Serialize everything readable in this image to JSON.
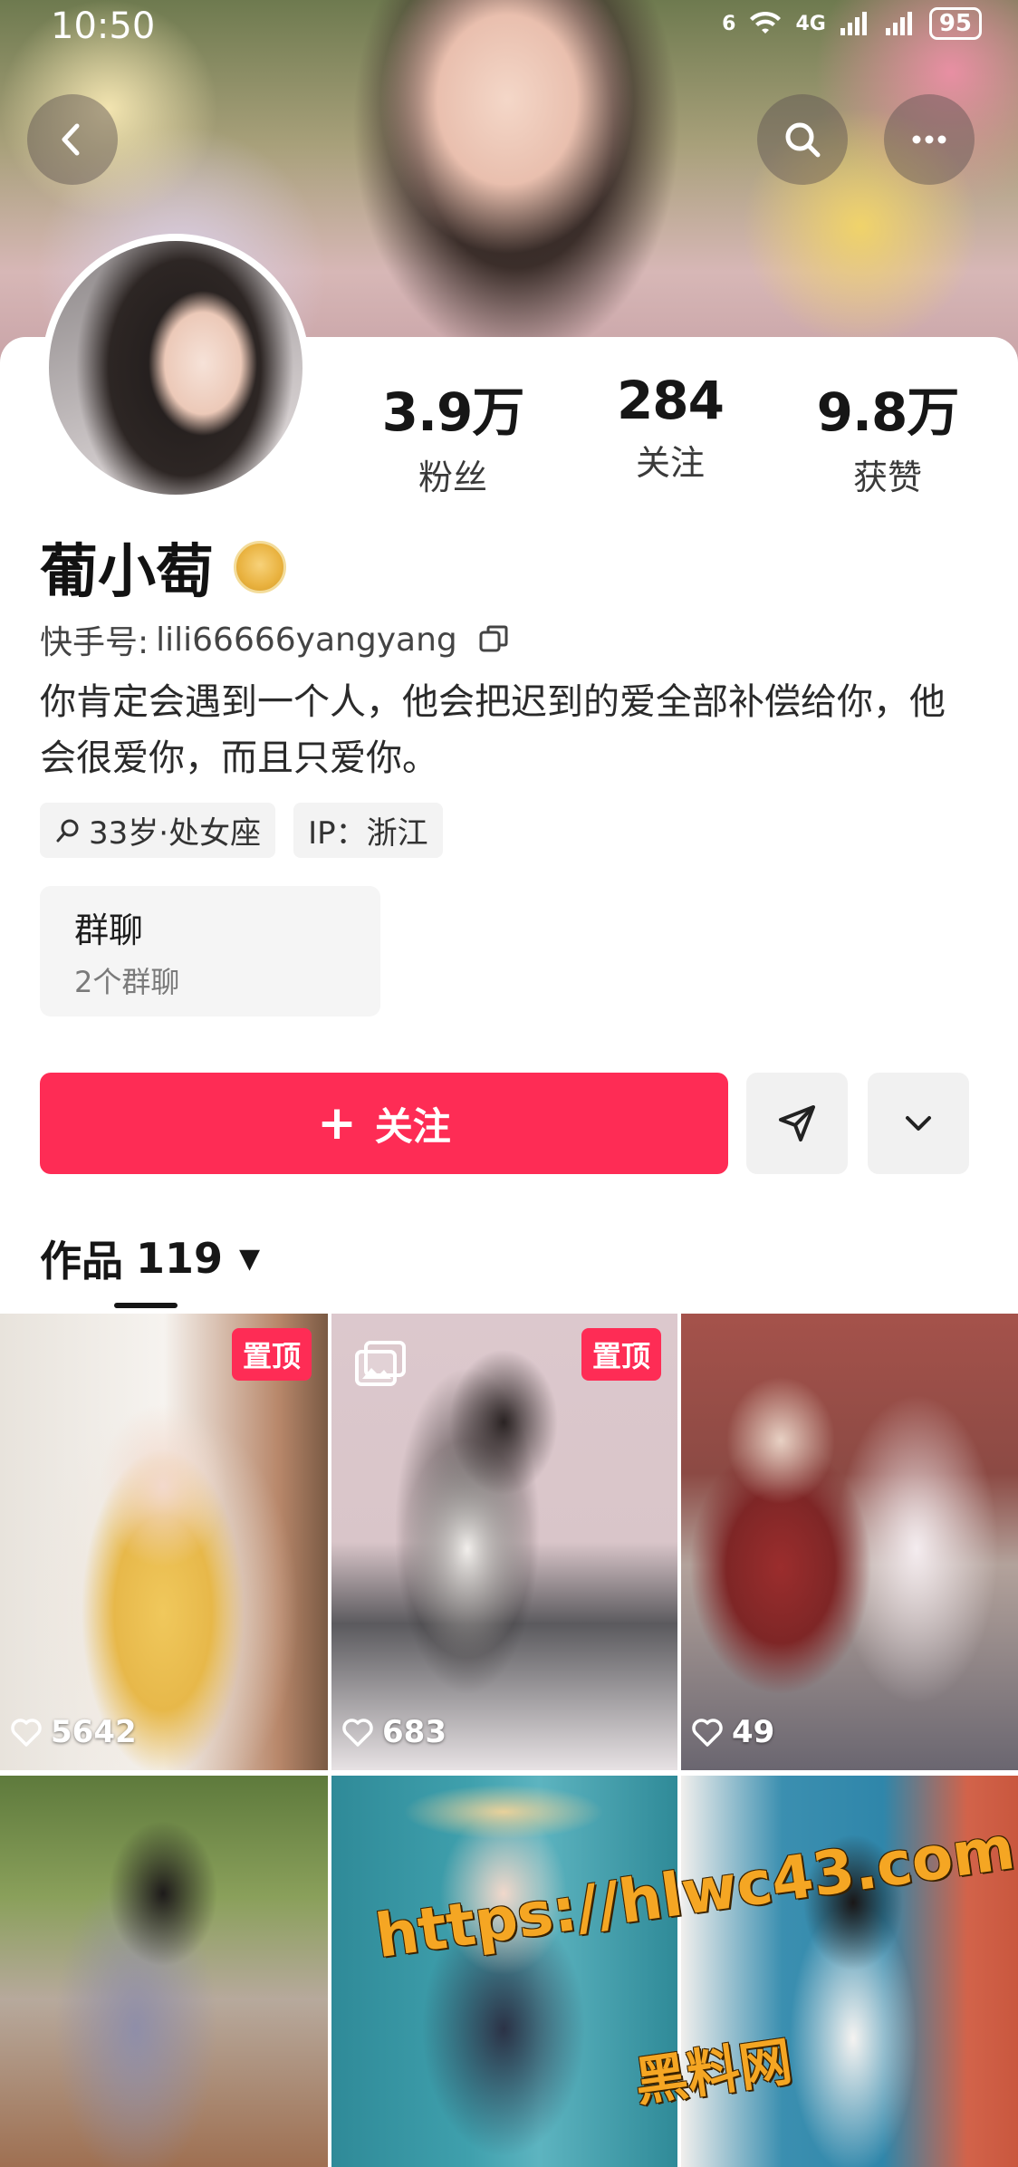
{
  "status_bar": {
    "time": "10:50",
    "network": "4G",
    "signal_prefix": "6",
    "battery": "95"
  },
  "header": {
    "back_icon": "chevron-left-icon",
    "search_icon": "search-icon",
    "more_icon": "more-horizontal-icon"
  },
  "profile": {
    "name": "葡小萄",
    "account_label": "快手号:",
    "account_id": "lili66666yangyang",
    "bio": "你肯定会遇到一个人，他会把迟到的爱全部补偿给你，他会很爱你，而且只爱你。",
    "tags": [
      {
        "label": "33岁·处女座",
        "icon": "search-icon"
      },
      {
        "label": "IP：浙江"
      }
    ]
  },
  "stats": [
    {
      "value": "3.9万",
      "label": "粉丝"
    },
    {
      "value": "284",
      "label": "关注"
    },
    {
      "value": "9.8万",
      "label": "获赞"
    }
  ],
  "group_chat": {
    "title": "群聊",
    "subtitle": "2个群聊"
  },
  "actions": {
    "follow_label": "关注",
    "follow_plus": "+",
    "colors": {
      "accent": "#fe2c55"
    }
  },
  "works": {
    "tab_label": "作品",
    "count": "119"
  },
  "posts": [
    {
      "likes": "5642",
      "pinned": true,
      "pin_label": "置顶",
      "multi_image": false
    },
    {
      "likes": "683",
      "pinned": true,
      "pin_label": "置顶",
      "multi_image": true
    },
    {
      "likes": "49",
      "pinned": false,
      "multi_image": false
    },
    {
      "likes": "",
      "pinned": false,
      "multi_image": false
    },
    {
      "likes": "",
      "pinned": false,
      "multi_image": false
    },
    {
      "likes": "",
      "pinned": false,
      "multi_image": false
    }
  ],
  "watermark": {
    "url": "https://hlwc43.com",
    "name": "黑料网"
  }
}
